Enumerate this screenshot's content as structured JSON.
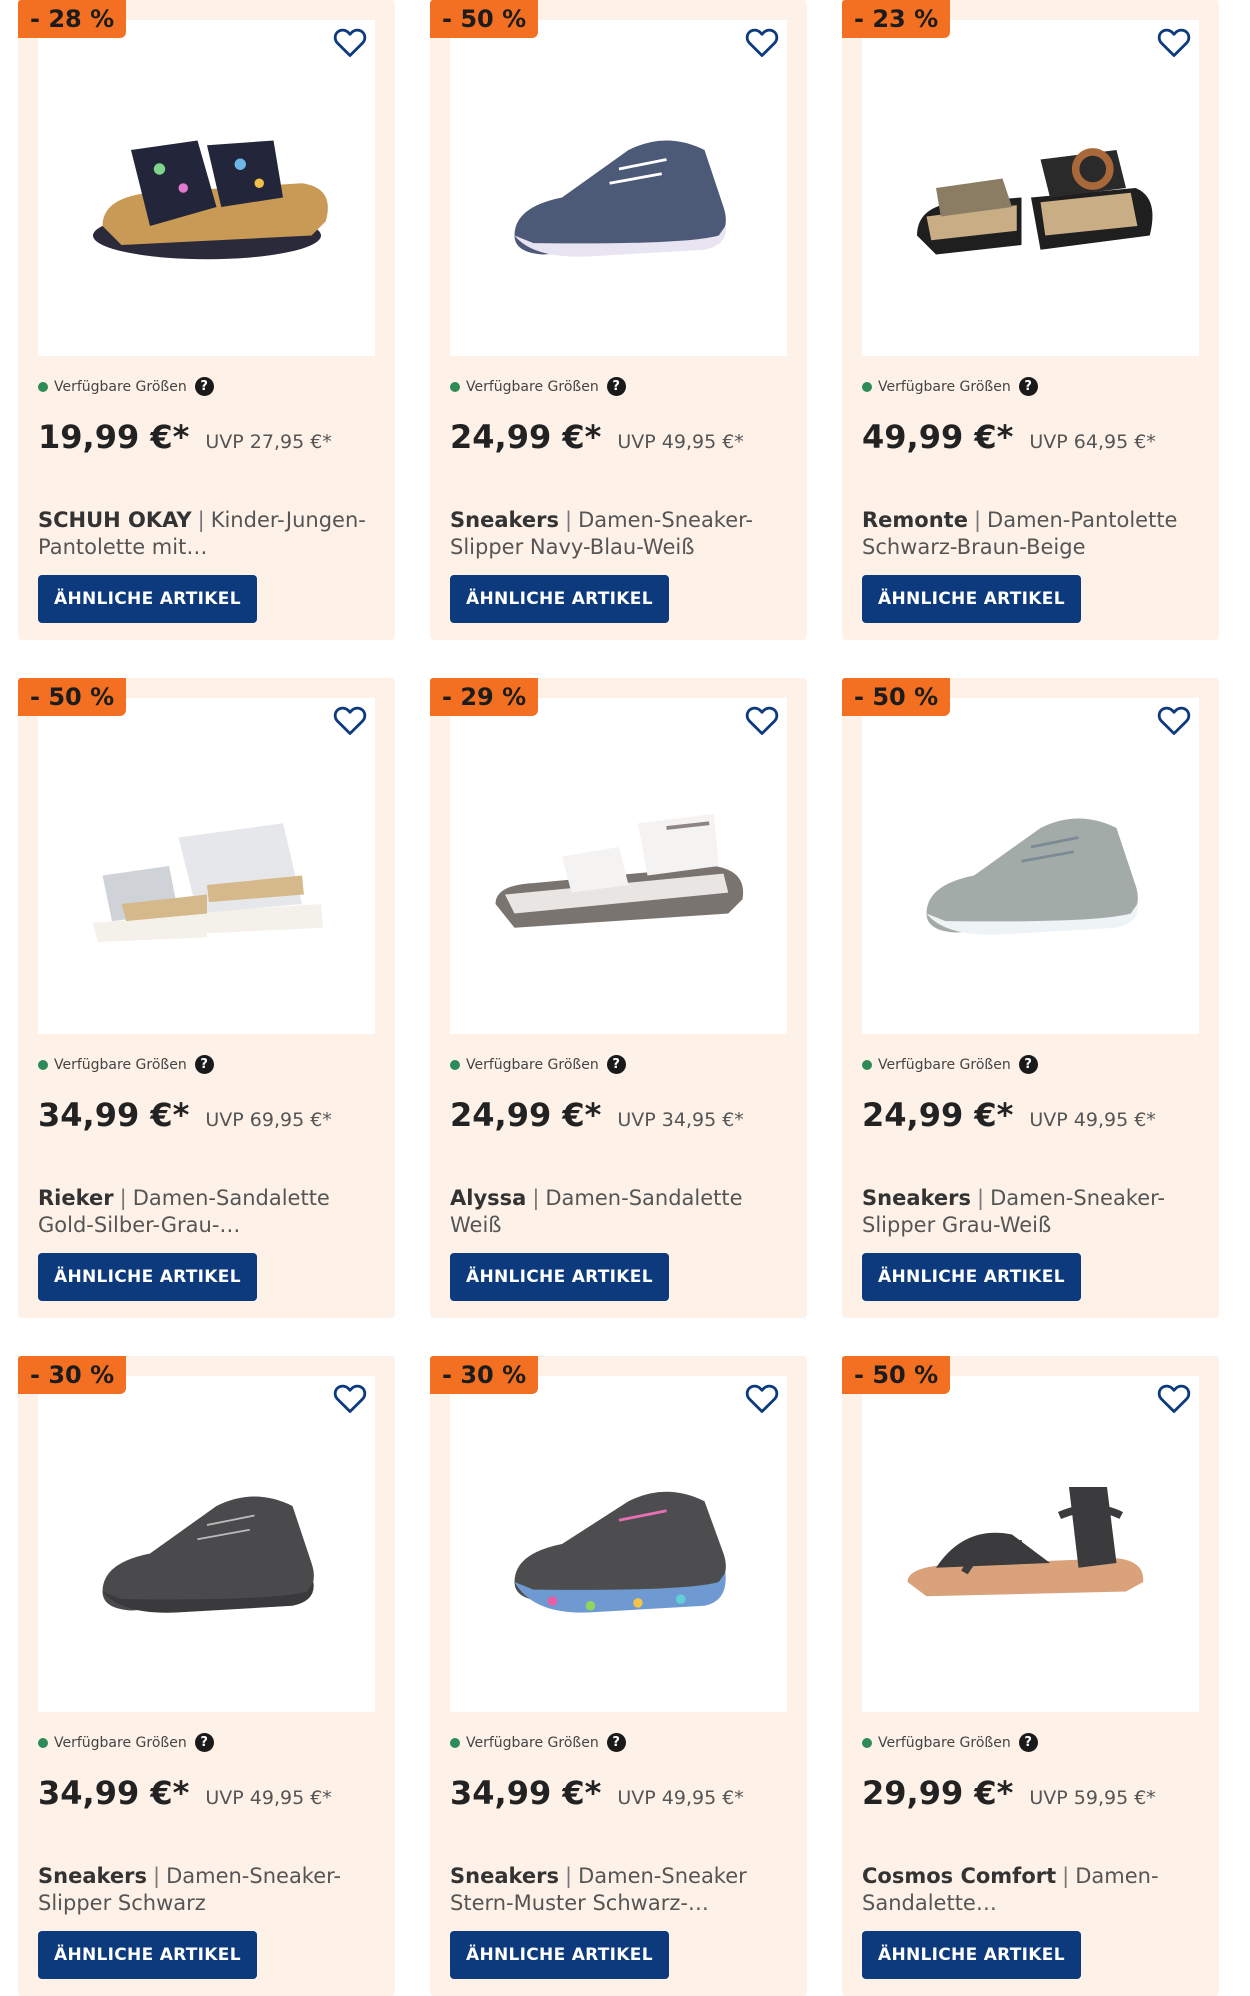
{
  "labels": {
    "available_sizes": "Verfügbare Größen",
    "help": "?",
    "similar": "ÄHNLICHE ARTIKEL",
    "separator": "|"
  },
  "products": [
    {
      "discount": "- 28 %",
      "price": "19,99 €*",
      "uvp": "UVP 27,95 €*",
      "brand": "SCHUH OKAY",
      "name": "SCHUH OKAY Kinder-Jungen-Pantolette mit…",
      "image": "kids-sandal-dinosaur"
    },
    {
      "discount": "- 50 %",
      "price": "24,99 €*",
      "uvp": "UVP 49,95 €*",
      "brand": "Sneakers",
      "name": "Sneakers Damen-Sneaker-Slipper Navy-Blau-Weiß",
      "image": "navy-sneaker"
    },
    {
      "discount": "- 23 %",
      "price": "49,99 €*",
      "uvp": "UVP 64,95 €*",
      "brand": "Remonte",
      "name": "Remonte Damen-Pantolette Schwarz-Braun-Beige",
      "image": "black-buckle-slide"
    },
    {
      "discount": "- 50 %",
      "price": "34,99 €*",
      "uvp": "UVP 69,95 €*",
      "brand": "Rieker",
      "name": "Rieker Damen-Sandalette Gold-Silber-Grau-…",
      "image": "silver-gold-sandal"
    },
    {
      "discount": "- 29 %",
      "price": "24,99 €*",
      "uvp": "UVP 34,95 €*",
      "brand": "Alyssa",
      "name": "Alyssa Damen-Sandalette Weiß",
      "image": "white-trek-sandal"
    },
    {
      "discount": "- 50 %",
      "price": "24,99 €*",
      "uvp": "UVP 49,95 €*",
      "brand": "Sneakers",
      "name": "Sneakers Damen-Sneaker-Slipper Grau-Weiß",
      "image": "grey-sneaker"
    },
    {
      "discount": "- 30 %",
      "price": "34,99 €*",
      "uvp": "UVP 49,95 €*",
      "brand": "Sneakers",
      "name": "Sneakers Damen-Sneaker-Slipper Schwarz",
      "image": "black-sneaker"
    },
    {
      "discount": "- 30 %",
      "price": "34,99 €*",
      "uvp": "UVP 49,95 €*",
      "brand": "Sneakers",
      "name": "Sneakers Damen-Sneaker Stern-Muster Schwarz-…",
      "image": "star-pattern-sneaker"
    },
    {
      "discount": "- 50 %",
      "price": "29,99 €*",
      "uvp": "UVP 59,95 €*",
      "brand": "Cosmos Comfort",
      "name": "Cosmos Comfort Damen-Sandalette…",
      "image": "black-woven-sandal"
    }
  ],
  "colors": {
    "badge": "#f36f21",
    "card_bg": "#fdf1e8",
    "button": "#0c3a7c",
    "available_dot": "#2e8b57"
  }
}
